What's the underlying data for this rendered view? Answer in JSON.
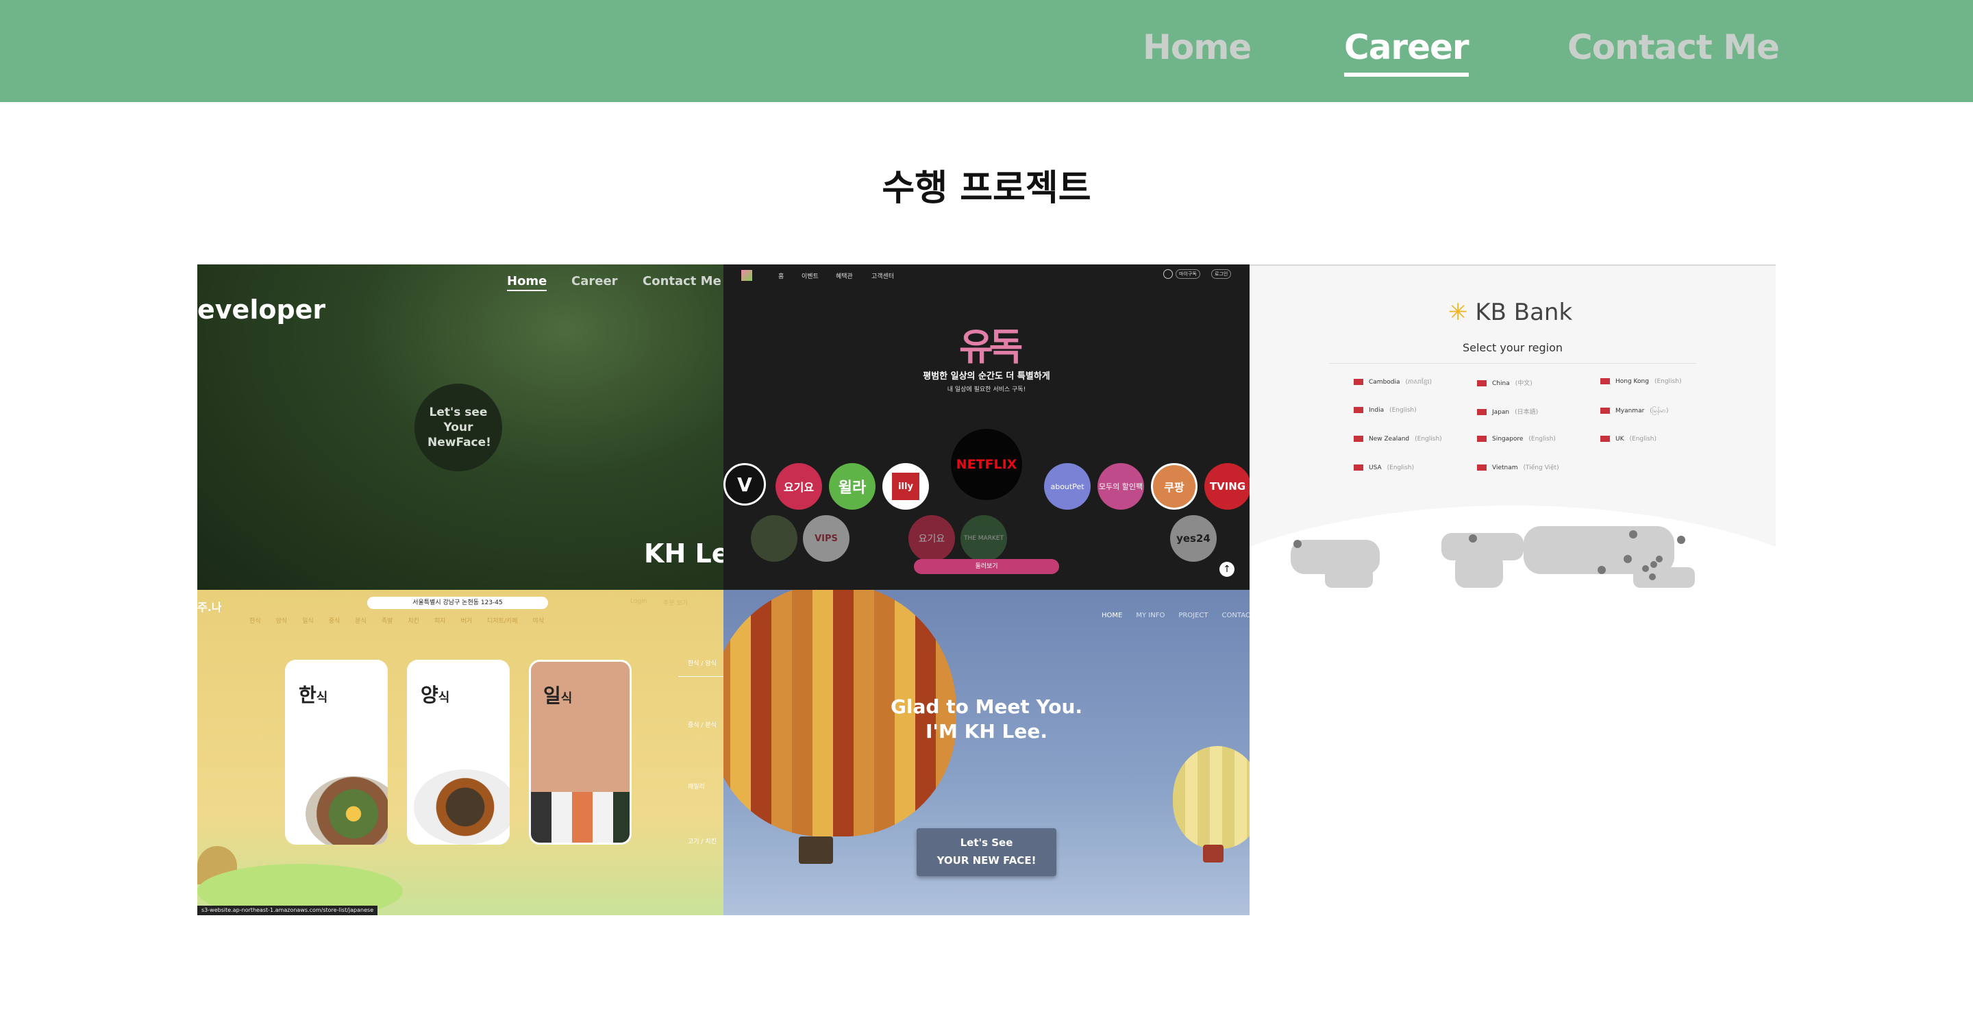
{
  "nav": {
    "items": [
      {
        "label": "Home",
        "active": false
      },
      {
        "label": "Career",
        "active": true
      },
      {
        "label": "Contact Me",
        "active": false
      }
    ]
  },
  "section": {
    "title": "수행 프로젝트"
  },
  "projects": {
    "p1": {
      "brand": "eveloper",
      "nav": [
        "Home",
        "Career",
        "Contact Me"
      ],
      "circle": "Let's see Your NewFace!",
      "name": "KH Le"
    },
    "p2": {
      "nav": [
        "홈",
        "이벤트",
        "혜택관",
        "고객센터"
      ],
      "top_buttons": [
        "마이구독",
        "로그인"
      ],
      "logo": "유독",
      "headline": "평범한 일상의 순간도 더 특별하게",
      "sub": "내 일상에 필요한 서비스 구독!",
      "brands": [
        "V",
        "요기요",
        "윌라",
        "illy",
        "NETFLIX",
        "aboutPet",
        "모두의 할인팩",
        "쿠팡",
        "TVING"
      ],
      "brands2": [
        "VIPS",
        "요기요",
        "THE MARKET",
        "yes24"
      ],
      "button": "둘러보기"
    },
    "p3": {
      "logo": "KB Bank",
      "subtitle": "Select your region",
      "regions": [
        {
          "name": "Cambodia",
          "lang": "(ភាសាខ្មែរ)"
        },
        {
          "name": "China",
          "lang": "(中文)"
        },
        {
          "name": "Hong Kong",
          "lang": "(English)"
        },
        {
          "name": "India",
          "lang": "(English)"
        },
        {
          "name": "Japan",
          "lang": "(日本語)"
        },
        {
          "name": "Myanmar",
          "lang": "(မြန်မာ)"
        },
        {
          "name": "New Zealand",
          "lang": "(English)"
        },
        {
          "name": "Singapore",
          "lang": "(English)"
        },
        {
          "name": "UK",
          "lang": "(English)"
        },
        {
          "name": "USA",
          "lang": "(English)"
        },
        {
          "name": "Vietnam",
          "lang": "(Tiếng Việt)"
        }
      ]
    },
    "p4": {
      "logo": "주.나",
      "address": "서울특별시 강남구 논현동 123-45",
      "menu": [
        "한식",
        "양식",
        "일식",
        "중식",
        "분식",
        "족발",
        "치킨",
        "피자",
        "버거",
        "디저트/카페",
        "야식"
      ],
      "top_links": [
        "Login",
        "주문 보기"
      ],
      "cards": [
        {
          "big": "한",
          "small": "식"
        },
        {
          "big": "양",
          "small": "식"
        },
        {
          "big": "일",
          "small": "식"
        }
      ],
      "side": [
        "한식 / 양식",
        "중식 / 분식",
        "패밀리",
        "고기 / 치킨"
      ],
      "status": "s3-website.ap-northeast-1.amazonaws.com/store-list/japanese"
    },
    "p5": {
      "nav": [
        "HOME",
        "MY INFO",
        "PROJECT",
        "CONTACT"
      ],
      "line1": "Glad to Meet You.",
      "line2": "I'M KH Lee.",
      "btn1": "Let's See",
      "btn2": "YOUR NEW FACE!"
    }
  },
  "colors": {
    "topbar": "#6fb589",
    "active": "#ffffff",
    "inactive": "#c9cfcb"
  }
}
